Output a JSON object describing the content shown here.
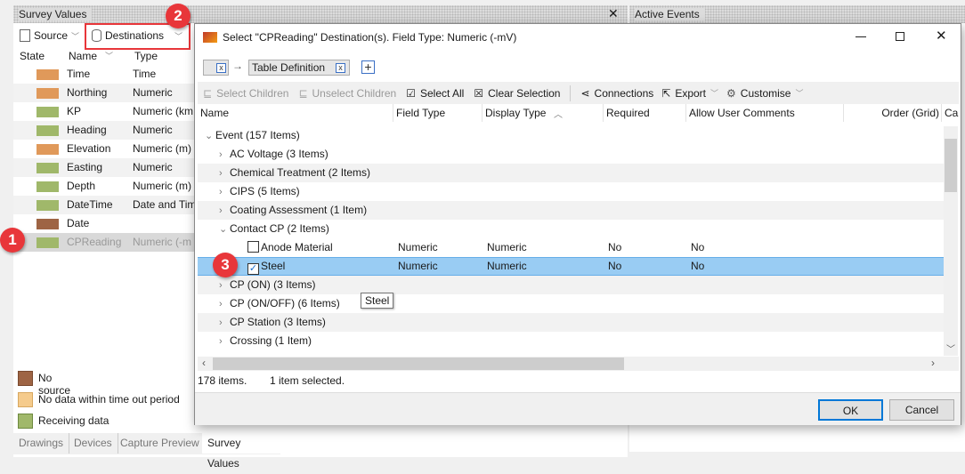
{
  "left_panel": {
    "title": "Survey Values",
    "toolbar": {
      "source": "Source",
      "destinations": "Destinations"
    },
    "columns": [
      "State",
      "Name",
      "Type"
    ],
    "rows": [
      {
        "name": "Time",
        "type": "Time",
        "state_color": "#e0995a"
      },
      {
        "name": "Northing",
        "type": "Numeric",
        "state_color": "#e0995a"
      },
      {
        "name": "KP",
        "type": "Numeric (km",
        "state_color": "#a0b86a"
      },
      {
        "name": "Heading",
        "type": "Numeric",
        "state_color": "#a0b86a"
      },
      {
        "name": "Elevation",
        "type": "Numeric (m)",
        "state_color": "#e0995a"
      },
      {
        "name": "Easting",
        "type": "Numeric",
        "state_color": "#a0b86a"
      },
      {
        "name": "Depth",
        "type": "Numeric (m)",
        "state_color": "#a0b86a"
      },
      {
        "name": "DateTime",
        "type": "Date and Tim",
        "state_color": "#a0b86a"
      },
      {
        "name": "Date",
        "type": "",
        "state_color": "#9e6444"
      },
      {
        "name": "CPReading",
        "type": "Numeric (-m",
        "state_color": "#a0b86a"
      }
    ],
    "legend": [
      {
        "label": "No source",
        "color": "#9e6444"
      },
      {
        "label": "No data within time out period",
        "color": "#f5cb8c"
      },
      {
        "label": "Receiving data",
        "color": "#a0b86a"
      }
    ],
    "tabs": [
      "Drawings",
      "Devices",
      "Capture Preview",
      "Survey Values"
    ],
    "active_tab": "Survey Values"
  },
  "right_panel": {
    "title": "Active Events"
  },
  "dialog": {
    "title": "Select \"CPReading\" Destination(s). Field Type: Numeric (-mV)",
    "chip_label": "Table Definition",
    "toolbar": {
      "select_children": "Select Children",
      "unselect_children": "Unselect Children",
      "select_all": "Select All",
      "clear_selection": "Clear Selection",
      "connections": "Connections",
      "export": "Export",
      "customise": "Customise"
    },
    "columns": [
      "Name",
      "Field Type",
      "Display Type",
      "Required",
      "Allow User Comments",
      "Order (Grid)",
      "Ca"
    ],
    "rows": [
      {
        "level": 0,
        "label": "Event (157 Items)",
        "expanded": true
      },
      {
        "level": 1,
        "label": "AC Voltage (3 Items)"
      },
      {
        "level": 1,
        "label": "Chemical Treatment (2 Items)"
      },
      {
        "level": 1,
        "label": "CIPS (5 Items)"
      },
      {
        "level": 1,
        "label": "Coating Assessment (1 Item)"
      },
      {
        "level": 1,
        "label": "Contact CP (2 Items)",
        "expanded": true
      },
      {
        "level": 2,
        "label": "Anode Material",
        "checked": false,
        "field_type": "Numeric",
        "display_type": "Numeric",
        "required": "No",
        "comments": "No"
      },
      {
        "level": 2,
        "label": "Steel",
        "checked": true,
        "selected": true,
        "field_type": "Numeric",
        "display_type": "Numeric",
        "required": "No",
        "comments": "No"
      },
      {
        "level": 1,
        "label": "CP (ON) (3 Items)"
      },
      {
        "level": 1,
        "label": "CP (ON/OFF) (6 Items)"
      },
      {
        "level": 1,
        "label": "CP Station (3 Items)"
      },
      {
        "level": 1,
        "label": "Crossing (1 Item)"
      }
    ],
    "tooltip": "Steel",
    "status": {
      "count": "178 items.",
      "selected": "1 item selected."
    },
    "ok": "OK",
    "cancel": "Cancel"
  },
  "badges": [
    "1",
    "2",
    "3"
  ]
}
